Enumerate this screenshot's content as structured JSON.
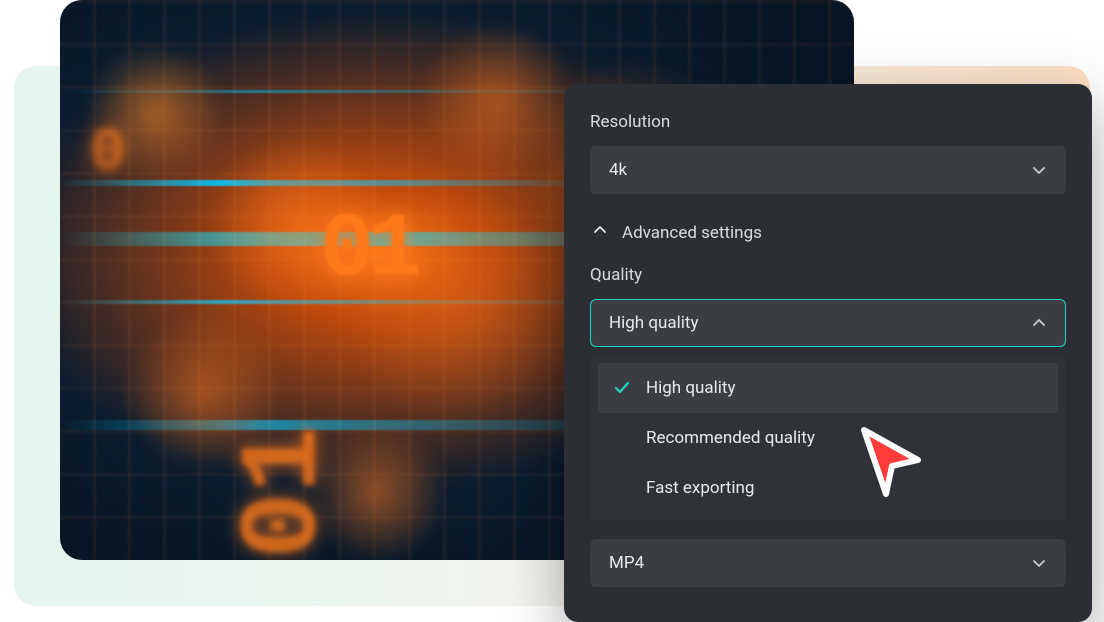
{
  "colors": {
    "panel_bg": "#2b2f33",
    "field_bg": "#3a3e43",
    "accent": "#22d3c5",
    "text": "#d9dde1",
    "cursor_fill": "#ff3b3b"
  },
  "resolution": {
    "label": "Resolution",
    "selected": "4k"
  },
  "advanced": {
    "label": "Advanced settings",
    "expanded": true
  },
  "quality": {
    "label": "Quality",
    "selected": "High quality",
    "open": true,
    "options": [
      {
        "label": "High quality",
        "selected": true
      },
      {
        "label": "Recommended quality",
        "selected": false
      },
      {
        "label": "Fast exporting",
        "selected": false
      }
    ]
  },
  "format": {
    "selected": "MP4"
  }
}
